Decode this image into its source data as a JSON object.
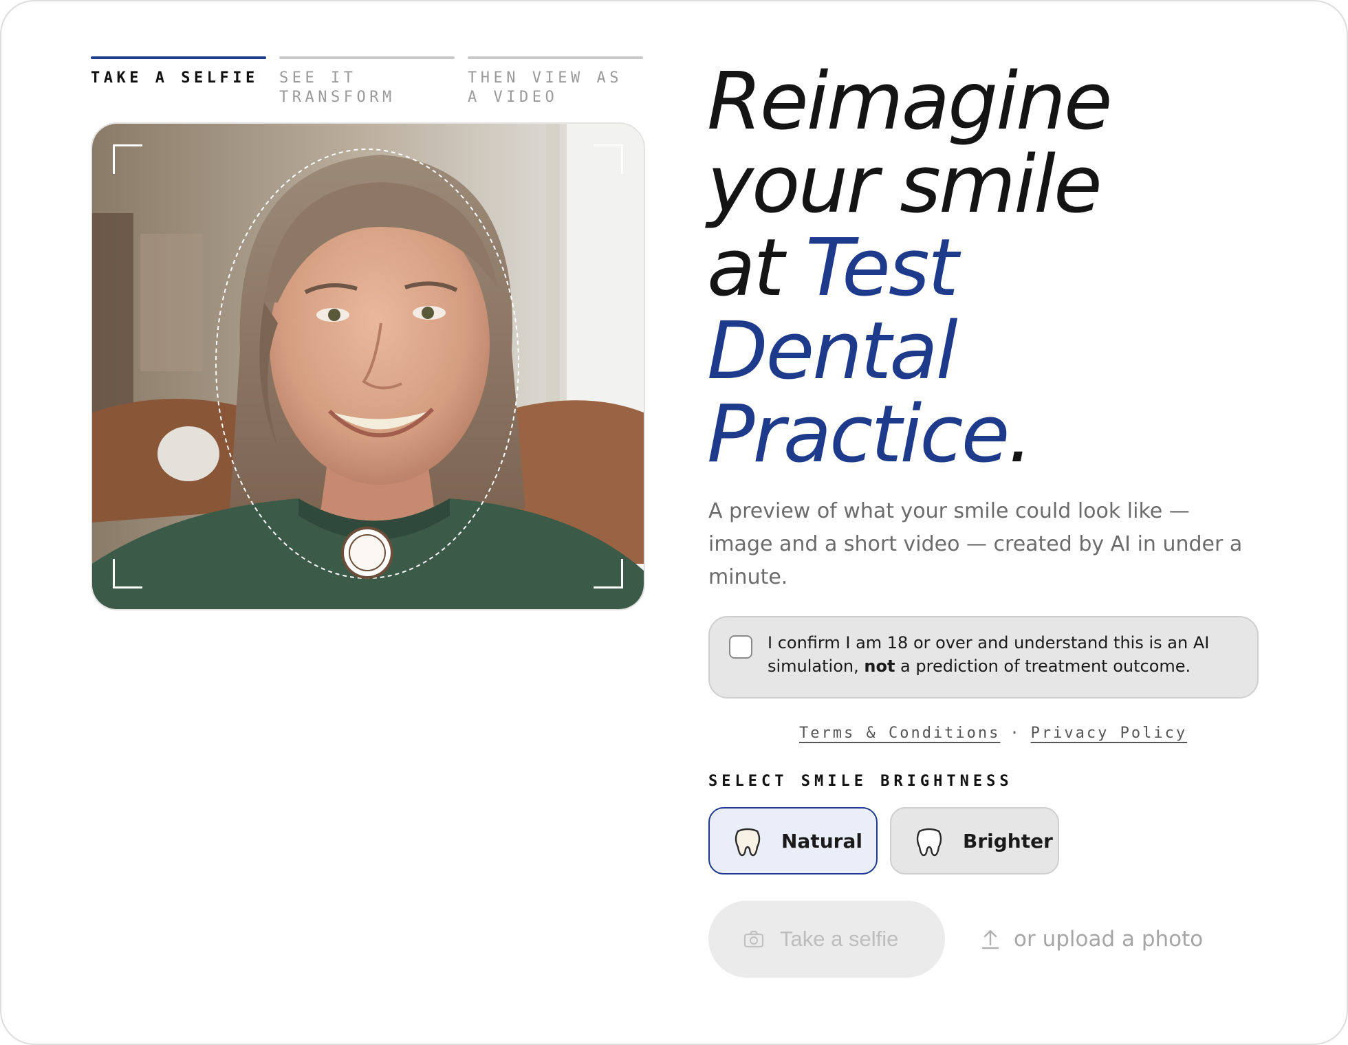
{
  "steps": [
    {
      "label": "TAKE A SELFIE",
      "active": true
    },
    {
      "label": "SEE IT TRANSFORM",
      "active": false
    },
    {
      "label": "THEN VIEW AS A VIDEO",
      "active": false
    }
  ],
  "headline": {
    "line1": "Reimagine",
    "line2": "your smile",
    "line3_prefix": "at ",
    "accent_1": "Test",
    "accent_2": "Dental",
    "accent_3": "Practice",
    "period": "."
  },
  "subtitle": "A preview of what your smile could look like — image and a short video — created by AI in under a minute.",
  "consent": {
    "text_before": "I confirm I am 18 or over and understand this is an AI simulation, ",
    "text_bold": "not",
    "text_after": " a prediction of treatment outcome.",
    "checked": false
  },
  "legal": {
    "terms": "Terms & Conditions",
    "separator": "·",
    "privacy": "Privacy Policy"
  },
  "brightness": {
    "label": "SELECT SMILE BRIGHTNESS",
    "options": [
      {
        "label": "Natural",
        "selected": true,
        "icon": "tooth-icon"
      },
      {
        "label": "Brighter",
        "selected": false,
        "icon": "tooth-icon"
      }
    ]
  },
  "actions": {
    "selfie_label": "Take a selfie",
    "selfie_icon": "camera-icon",
    "upload_label": "or upload a photo",
    "upload_icon": "upload-icon"
  },
  "colors": {
    "accent": "#1e3a8a",
    "text": "#141414",
    "muted": "#6b6b6b",
    "panel": "#e6e6e6"
  }
}
